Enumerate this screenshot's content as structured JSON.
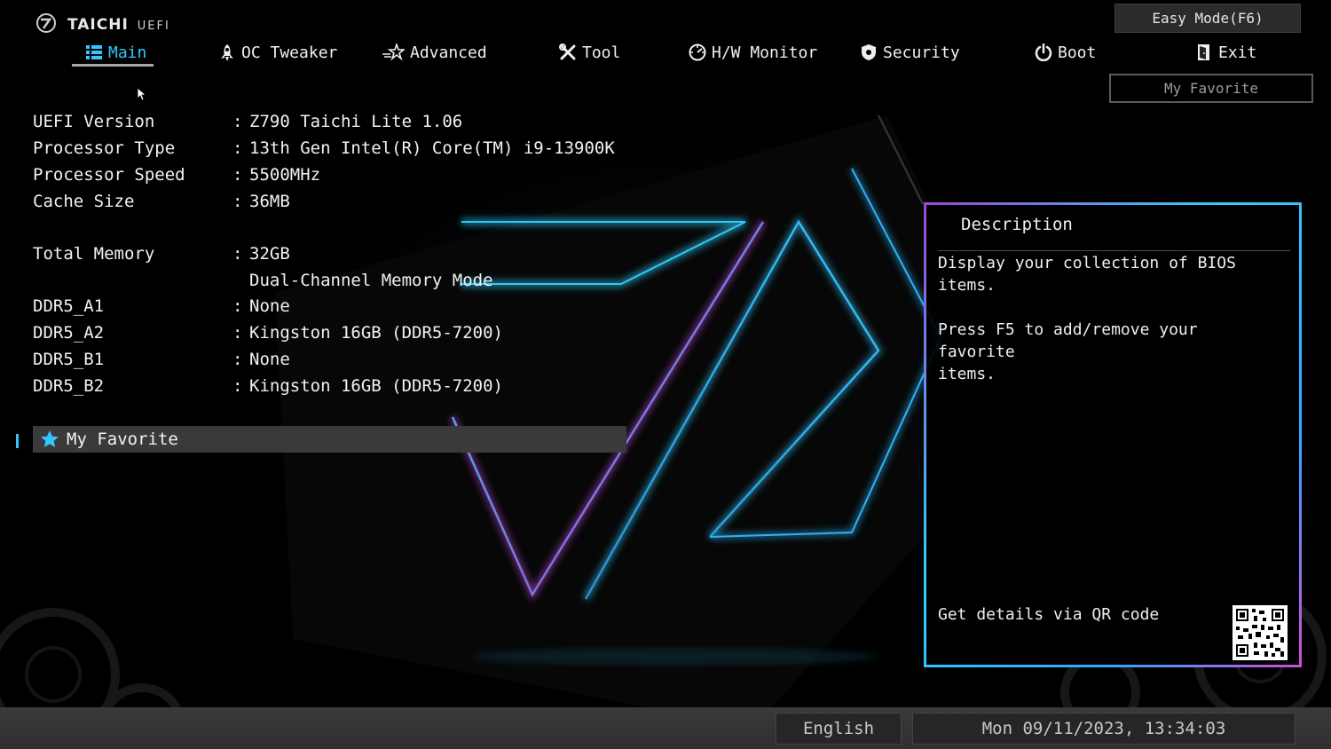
{
  "logo": {
    "brand": "TAICHI",
    "suffix": "UEFI"
  },
  "nav": {
    "tabs": [
      {
        "label": "Main",
        "icon": "list-icon",
        "active": true
      },
      {
        "label": "OC Tweaker",
        "icon": "rocket-icon"
      },
      {
        "label": "Advanced",
        "icon": "star-swoosh-icon"
      },
      {
        "label": "Tool",
        "icon": "tools-icon"
      },
      {
        "label": "H/W Monitor",
        "icon": "monitor-dial-icon"
      },
      {
        "label": "Security",
        "icon": "shield-icon"
      },
      {
        "label": "Boot",
        "icon": "power-icon"
      },
      {
        "label": "Exit",
        "icon": "door-exit-icon"
      }
    ]
  },
  "easy_mode_label": "Easy Mode(F6)",
  "my_favorite_button": "My Favorite",
  "info": {
    "separator": ":",
    "rows": [
      {
        "key": "UEFI Version",
        "value": "Z790 Taichi Lite 1.06"
      },
      {
        "key": "Processor Type",
        "value": "13th Gen Intel(R) Core(TM) i9-13900K"
      },
      {
        "key": "Processor Speed",
        "value": "5500MHz"
      },
      {
        "key": "Cache Size",
        "value": "36MB"
      },
      {
        "key": "Total Memory",
        "value": "32GB"
      },
      {
        "key": "",
        "value": "Dual-Channel Memory Mode"
      },
      {
        "key": "DDR5_A1",
        "value": "None"
      },
      {
        "key": "DDR5_A2",
        "value": "Kingston 16GB (DDR5-7200)"
      },
      {
        "key": "DDR5_B1",
        "value": "None"
      },
      {
        "key": "DDR5_B2",
        "value": "Kingston 16GB (DDR5-7200)"
      }
    ]
  },
  "favorite_row": {
    "label": "My Favorite",
    "icon": "star-icon"
  },
  "description": {
    "title": "Description",
    "paragraph1": "Display your collection of BIOS\nitems.",
    "paragraph2": "Press F5 to add/remove your favorite\nitems.",
    "qr_label": "Get details via QR code"
  },
  "footer": {
    "language": "English",
    "datetime": "Mon 09/11/2023, 13:34:03"
  },
  "colors": {
    "accent": "#34c5ff",
    "panel_border_start": "#d24bd8",
    "panel_border_end": "#2fd0ff"
  }
}
